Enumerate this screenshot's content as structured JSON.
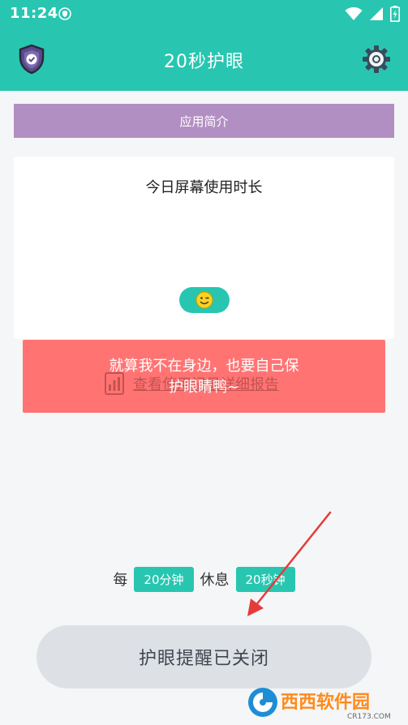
{
  "status_bar": {
    "time": "11:24",
    "icons": [
      "vpn-shield-icon",
      "wifi-icon",
      "signal-icon",
      "battery-charging-icon"
    ]
  },
  "app_bar": {
    "title": "20秒护眼",
    "left_icon": "shield-check-icon",
    "right_icon": "gear-icon"
  },
  "intro": {
    "label": "应用简介"
  },
  "usage_card": {
    "title": "今日屏幕使用时长",
    "indicator_icon": "smiley-face-icon"
  },
  "report": {
    "label": "查看使用记录详细报告",
    "icon": "report-chart-icon"
  },
  "toast": {
    "line1": "就算我不在身边，也要自己保",
    "line2": "护眼睛鸭~"
  },
  "interval": {
    "every_label": "每",
    "work_duration": "20分钟",
    "rest_label": "休息",
    "rest_duration": "20秒钟"
  },
  "toggle": {
    "label": "护眼提醒已关闭"
  },
  "watermark": {
    "text": "西西软件园",
    "sub": "CR173.COM"
  },
  "colors": {
    "primary": "#28c6b0",
    "intro_purple": "#b28fc3",
    "toast_red": "#ff7473",
    "toggle_gray": "#dde1e6",
    "background": "#f5f6f7"
  }
}
